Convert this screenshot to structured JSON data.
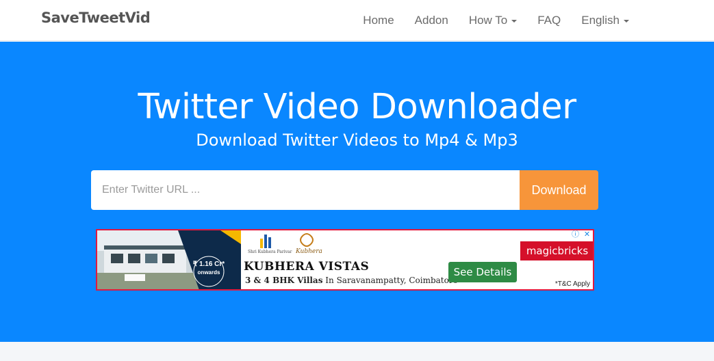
{
  "navbar": {
    "brand": "SaveTweetVid",
    "items": [
      {
        "label": "Home",
        "dropdown": false
      },
      {
        "label": "Addon",
        "dropdown": false
      },
      {
        "label": "How To",
        "dropdown": true
      },
      {
        "label": "FAQ",
        "dropdown": false
      },
      {
        "label": "English",
        "dropdown": true
      }
    ]
  },
  "hero": {
    "title": "Twitter Video Downloader",
    "subtitle": "Download Twitter Videos to Mp4 & Mp3",
    "input_placeholder": "Enter Twitter URL ...",
    "input_value": "",
    "button_label": "Download"
  },
  "ad": {
    "title": "KUBHERA VISTAS",
    "sub_bold": "3 & 4 BHK Villas",
    "sub_rest": " In Saravanampatty, Coimbatore",
    "price": "₹ 1.16 Cr*",
    "price_sub": "onwards",
    "cta": "See Details",
    "brand": "magicbricks",
    "tc": "*T&C Apply",
    "logo_left": "Shri Kubhera Parivar",
    "logo_right": "Kubhera"
  },
  "colors": {
    "hero_bg": "#0a87ff",
    "button": "#f7953a",
    "ad_border": "#e0193f",
    "ad_cta": "#2e8b45",
    "ad_brand": "#d5102a"
  },
  "icons": [
    "adchoices-icon",
    "close-icon"
  ]
}
